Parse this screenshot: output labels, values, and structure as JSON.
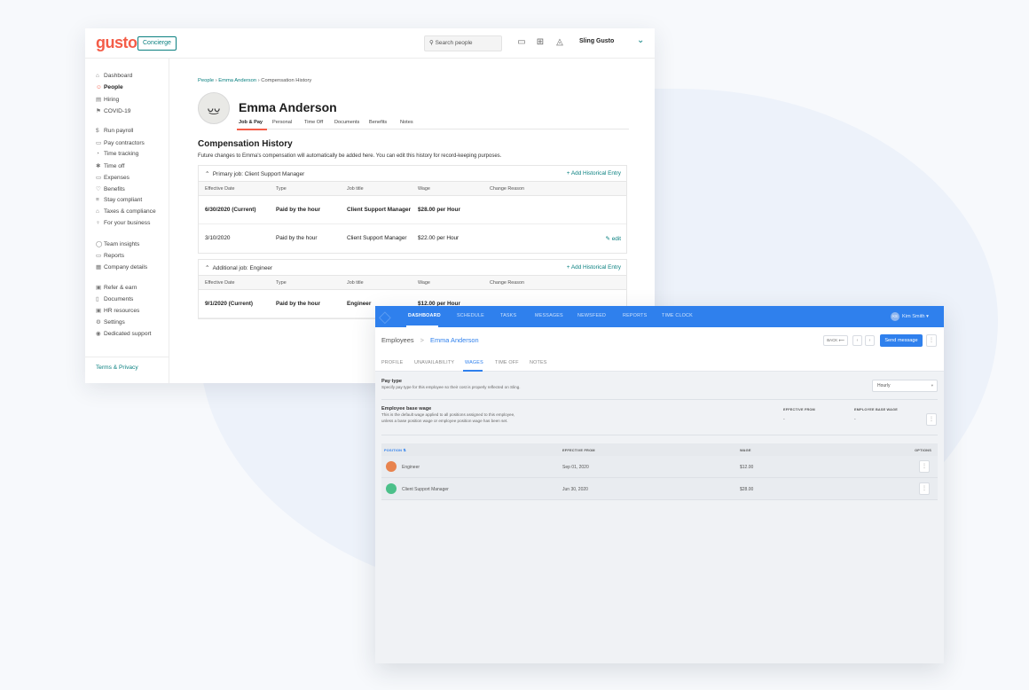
{
  "colors": {
    "gusto_accent": "#f45d48",
    "gusto_teal": "#0a8080",
    "sling_blue": "#2f80ed"
  },
  "gusto": {
    "logo": "gusto",
    "concierge": "Concierge",
    "search_placeholder": "Search people",
    "user": "Sling Gusto",
    "sidebar": [
      {
        "label": "Dashboard",
        "icon": "home-icon"
      },
      {
        "label": "People",
        "icon": "people-icon",
        "active": true
      },
      {
        "label": "Hiring",
        "icon": "hiring-icon"
      },
      {
        "label": "COVID-19",
        "icon": "flag-icon"
      },
      {
        "label": "Run payroll",
        "icon": "payroll-icon"
      },
      {
        "label": "Pay contractors",
        "icon": "contractors-icon"
      },
      {
        "label": "Time tracking",
        "icon": "clock-icon"
      },
      {
        "label": "Time off",
        "icon": "timeoff-icon"
      },
      {
        "label": "Expenses",
        "icon": "card-icon"
      },
      {
        "label": "Benefits",
        "icon": "heart-icon"
      },
      {
        "label": "Stay compliant",
        "icon": "list-icon"
      },
      {
        "label": "Taxes & compliance",
        "icon": "bank-icon"
      },
      {
        "label": "For your business",
        "icon": "bulb-icon"
      },
      {
        "label": "Team insights",
        "icon": "chat-icon"
      },
      {
        "label": "Reports",
        "icon": "folder-icon"
      },
      {
        "label": "Company details",
        "icon": "building-icon"
      },
      {
        "label": "Refer & earn",
        "icon": "gift-icon"
      },
      {
        "label": "Documents",
        "icon": "document-icon"
      },
      {
        "label": "HR resources",
        "icon": "book-icon"
      },
      {
        "label": "Settings",
        "icon": "gear-icon"
      },
      {
        "label": "Dedicated support",
        "icon": "support-icon"
      }
    ],
    "terms": "Terms & Privacy",
    "breadcrumb": {
      "people": "People",
      "sep1": "›",
      "employee": "Emma Anderson",
      "sep2": "›",
      "current": "Compensation History"
    },
    "employee_name": "Emma Anderson",
    "tabs": [
      "Job & Pay",
      "Personal",
      "Time Off",
      "Documents",
      "Benefits",
      "Notes"
    ],
    "heading": "Compensation History",
    "description": "Future changes to Emma's compensation will automatically be added here. You can edit this history for record-keeping purposes.",
    "columns": [
      "Effective Date",
      "Type",
      "Job title",
      "Wage",
      "Change Reason"
    ],
    "add_label": "+ Add Historical Entry",
    "edit_label": "edit",
    "jobs": [
      {
        "title": "Primary job: Client Support Manager",
        "rows": [
          {
            "date": "6/30/2020 (Current)",
            "type": "Paid by the hour",
            "job": "Client Support Manager",
            "wage": "$28.00 per Hour",
            "bold": true
          },
          {
            "date": "3/10/2020",
            "type": "Paid by the hour",
            "job": "Client Support Manager",
            "wage": "$22.00 per Hour",
            "bold": false
          }
        ]
      },
      {
        "title": "Additional job: Engineer",
        "rows": [
          {
            "date": "9/1/2020 (Current)",
            "type": "Paid by the hour",
            "job": "Engineer",
            "wage": "$12.00 per Hour",
            "bold": true
          }
        ]
      }
    ]
  },
  "sling": {
    "nav": [
      "DASHBOARD",
      "SCHEDULE",
      "TASKS",
      "MESSAGES",
      "NEWSFEED",
      "REPORTS",
      "TIME CLOCK"
    ],
    "user_initials": "KS",
    "user": "Kim Smith",
    "breadcrumb": {
      "root": "Employees",
      "sep": ">",
      "employee": "Emma Anderson"
    },
    "back_label": "BACK",
    "send_message": "Send message",
    "tabs": [
      "PROFILE",
      "UNAVAILABILITY",
      "WAGES",
      "TIME OFF",
      "NOTES"
    ],
    "pay_type": {
      "title": "Pay type",
      "desc": "Specify pay type for this employee so their cost is properly reflected on Sling.",
      "value": "Hourly"
    },
    "base_wage": {
      "title": "Employee base wage",
      "desc1": "This is the default wage applied to all positions assigned to this employee,",
      "desc2": "unless a base position wage or employee position wage has been set.",
      "col_effective": "EFFECTIVE FROM",
      "col_wage": "EMPLOYEE BASE WAGE",
      "effective": "-",
      "wage": "-"
    },
    "table": {
      "cols": [
        "POSITION",
        "EFFECTIVE FROM",
        "WAGE",
        "OPTIONS"
      ],
      "rows": [
        {
          "position": "Engineer",
          "color": "#e8834e",
          "effective": "Sep 01, 2020",
          "wage": "$12.00"
        },
        {
          "position": "Client Support Manager",
          "color": "#4cc08a",
          "effective": "Jun 30, 2020",
          "wage": "$28.00"
        }
      ]
    }
  }
}
